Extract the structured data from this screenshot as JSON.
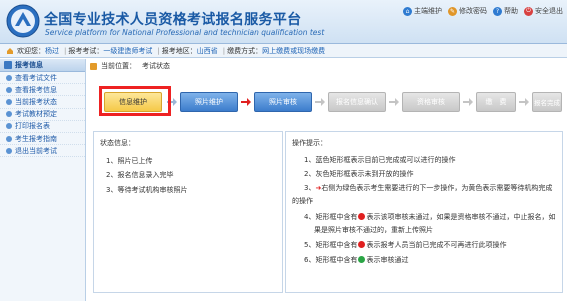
{
  "header": {
    "title_cn": "全国专业技术人员资格考试报名服务平台",
    "title_en": "Service platform for National Professional and technician qualification test",
    "actions": [
      {
        "label": "主端维护",
        "color": "#2f7bd1"
      },
      {
        "label": "修改密码",
        "color": "#e0962a"
      },
      {
        "label": "帮助",
        "color": "#2f7bd1"
      },
      {
        "label": "安全退出",
        "color": "#d84141"
      }
    ]
  },
  "infobar": {
    "welcome_label": "欢迎您：",
    "user": "杨过",
    "exam_label": "报考考试：",
    "exam": "一级建造师考试",
    "region_label": "报考地区：",
    "region": "山西省",
    "pay_label": "缴费方式：",
    "pay": "网上缴费或现场缴费"
  },
  "sidebar": {
    "head": "报考信息",
    "items": [
      {
        "label": "查看考试文件"
      },
      {
        "label": "查看报考信息"
      },
      {
        "label": "当前报考状态"
      },
      {
        "label": "考试教材预定"
      },
      {
        "label": "打印报名表"
      },
      {
        "label": "考生报考指南"
      },
      {
        "label": "退出当前考试"
      }
    ]
  },
  "breadcrumb": {
    "label": "当前位置：",
    "value": "考试状态"
  },
  "steps": [
    {
      "label": "信息维护",
      "state": "yellow"
    },
    {
      "label": "照片维护",
      "state": "blue"
    },
    {
      "label": "照片审核",
      "state": "blue"
    },
    {
      "label": "报名信息确认",
      "state": "gray"
    },
    {
      "label": "资格审核",
      "state": "gray"
    },
    {
      "label": "缴　费",
      "state": "gray"
    },
    {
      "label": "报名完成",
      "state": "gray"
    }
  ],
  "status_panel": {
    "title": "状态信息：",
    "lines": [
      "1、照片已上传",
      "2、报名信息录入完毕",
      "3、等待考试机构审核照片"
    ]
  },
  "help_panel": {
    "title": "操作提示：",
    "l1": "1、蓝色矩形框表示目前已完成或可以进行的操作",
    "l2": "2、灰色矩形框表示未到开放的操作",
    "l3a": "3、",
    "l3b": "右侧为绿色表示考生需要进行的下一步操作，为黄色表示需要等待机构完成",
    "l3c": "的操作",
    "l4a": "4、矩形框中含有",
    "l4b": "表示该项审核未通过，如果是资格审核不通过，中止报名，如",
    "l4c": "果是照片审核不通过的，重新上传照片",
    "l5a": "5、矩形框中含有",
    "l5b": "表示报考人员当前已完成不可再进行此项操作",
    "l6a": "6、矩形框中含有",
    "l6b": "表示审核通过"
  }
}
